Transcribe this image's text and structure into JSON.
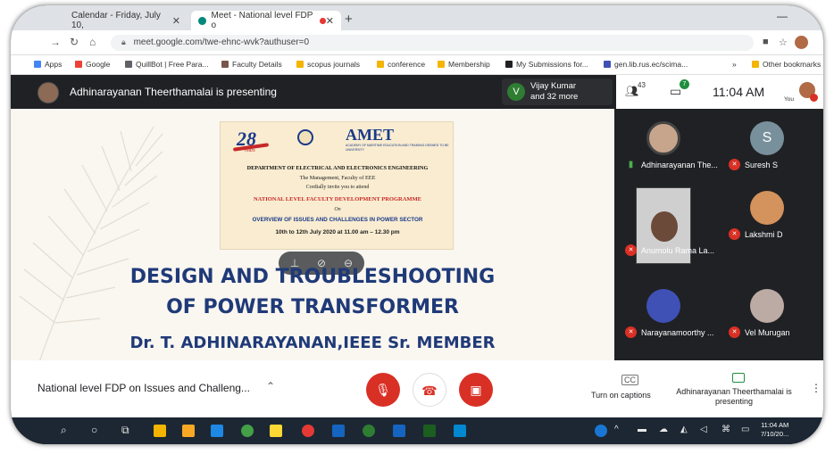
{
  "browser": {
    "tabs": [
      {
        "label": "Calendar - Friday, July 10,"
      },
      {
        "label": "Meet - National level FDP o"
      }
    ],
    "new_tab": "+",
    "url": "meet.google.com/twe-ehnc-wvk?authuser=0",
    "bookmarks": [
      {
        "label": "Apps",
        "color": "#4285f4"
      },
      {
        "label": "Google",
        "color": "#ea4335"
      },
      {
        "label": "QuillBot | Free Para...",
        "color": "#5f6368"
      },
      {
        "label": "Faculty Details",
        "color": "#795548"
      },
      {
        "label": "scopus journals",
        "color": "#f4b400"
      },
      {
        "label": "conference",
        "color": "#f4b400"
      },
      {
        "label": "Membership",
        "color": "#f4b400"
      },
      {
        "label": "My Submissions for...",
        "color": "#202124"
      },
      {
        "label": "gen.lib.rus.ec/scima...",
        "color": "#3f51b5"
      },
      {
        "label": "Other bookmarks",
        "color": "#f4b400"
      }
    ],
    "bookmarks_overflow": "»"
  },
  "meet_top": {
    "presenting": "Adhinarayanan Theerthamalai is presenting",
    "top_speaker_initial": "V",
    "top_speaker_line1": "Vijay Kumar",
    "top_speaker_line2": "and 32 more",
    "people_count": "43",
    "chat_badge": "7",
    "clock": "11:04 AM",
    "you_label": "You"
  },
  "slide": {
    "badge_number": "28",
    "badge_years": "Years",
    "org_title": "AMET",
    "org_subtitle": "ACADEMY OF MARITIME EDUCATION AND TRAINING DEEMED TO BE UNIVERSITY",
    "department": "DEPARTMENT OF ELECTRICAL AND ELECTRONICS ENGINEERING",
    "management": "The Management, Faculty of EEE",
    "cordially": "Cordially invite you to attend",
    "programme": "NATIONAL LEVEL FACULTY DEVELOPMENT PROGRAMME",
    "on": "On",
    "overview": "OVERVIEW OF ISSUES AND CHALLENGES IN POWER SECTOR",
    "dates": "10th to 12th July 2020 at 11.00 am – 12.30 pm",
    "title_line1": "DESIGN AND TROUBLESHOOTING",
    "title_line2": "OF POWER TRANSFORMER",
    "author": "Dr. T. ADHINARAYANAN,IEEE Sr. MEMBER"
  },
  "participants": [
    {
      "name": "Adhinarayanan The...",
      "muted": false
    },
    {
      "name": "Suresh S",
      "initial": "S",
      "muted": true
    },
    {
      "name": "Anumolu Rama La...",
      "muted": true
    },
    {
      "name": "Lakshmi D",
      "muted": true
    },
    {
      "name": "Narayanamoorthy ...",
      "muted": true
    },
    {
      "name": "Vel Murugan",
      "muted": true
    }
  ],
  "controls": {
    "meeting_title": "National level FDP on Issues and Challeng...",
    "captions_label": "Turn on captions",
    "captions_icon": "CC",
    "presenting_label": "Adhinarayanan Theerthamalai is presenting"
  },
  "taskbar": {
    "time": "11:04 AM",
    "date": "7/10/20..."
  },
  "colors": {
    "meet_dark": "#202124",
    "red_button": "#d93025",
    "slide_title": "#1f3a78"
  }
}
